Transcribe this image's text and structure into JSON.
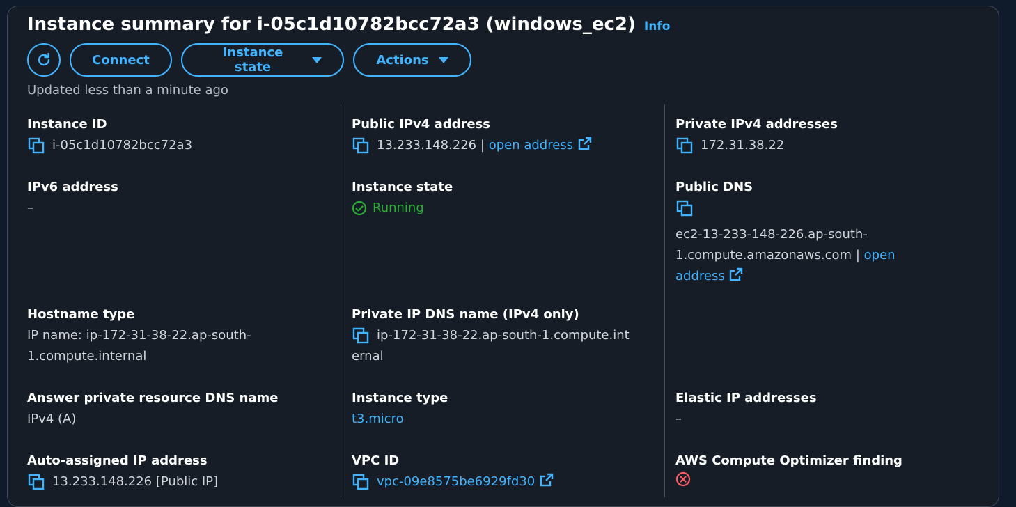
{
  "header": {
    "title": "Instance summary for i-05c1d10782bcc72a3 (windows_ec2)",
    "info_link": "Info"
  },
  "toolbar": {
    "refresh_icon": "refresh-icon",
    "connect_label": "Connect",
    "instance_state_label": "Instance state",
    "actions_label": "Actions"
  },
  "updated_text": "Updated less than a minute ago",
  "colors": {
    "accent": "#42b4ff",
    "running": "#29ad32",
    "error": "#ff5d64",
    "panel_bg": "#161d26"
  },
  "fields": {
    "instance_id": {
      "label": "Instance ID",
      "value": "i-05c1d10782bcc72a3"
    },
    "public_ipv4": {
      "label": "Public IPv4 address",
      "value": "13.233.148.226",
      "separator": "|",
      "link": "open address"
    },
    "private_ipv4": {
      "label": "Private IPv4 addresses",
      "value": "172.31.38.22"
    },
    "ipv6": {
      "label": "IPv6 address",
      "value": "–"
    },
    "instance_state": {
      "label": "Instance state",
      "value": "Running"
    },
    "public_dns": {
      "label": "Public DNS",
      "value_line1": "ec2-13-233-148-226.ap-south-",
      "value_line2": "1.compute.amazonaws.com",
      "separator": "|",
      "link_line1": "open",
      "link_line2": "address"
    },
    "hostname_type": {
      "label": "Hostname type",
      "value_line1": "IP name: ip-172-31-38-22.ap-south-",
      "value_line2": "1.compute.internal"
    },
    "private_ip_dns": {
      "label": "Private IP DNS name (IPv4 only)",
      "value_line1": "ip-172-31-38-22.ap-south-1.compute.int",
      "value_line2": "ernal"
    },
    "answer_private_dns": {
      "label": "Answer private resource DNS name",
      "value": "IPv4 (A)"
    },
    "instance_type": {
      "label": "Instance type",
      "value": "t3.micro"
    },
    "elastic_ip": {
      "label": "Elastic IP addresses",
      "value": "–"
    },
    "auto_assigned_ip": {
      "label": "Auto-assigned IP address",
      "value": "13.233.148.226 [Public IP]"
    },
    "vpc_id": {
      "label": "VPC ID",
      "value": "vpc-09e8575be6929fd30"
    },
    "optimizer": {
      "label": "AWS Compute Optimizer finding"
    }
  }
}
